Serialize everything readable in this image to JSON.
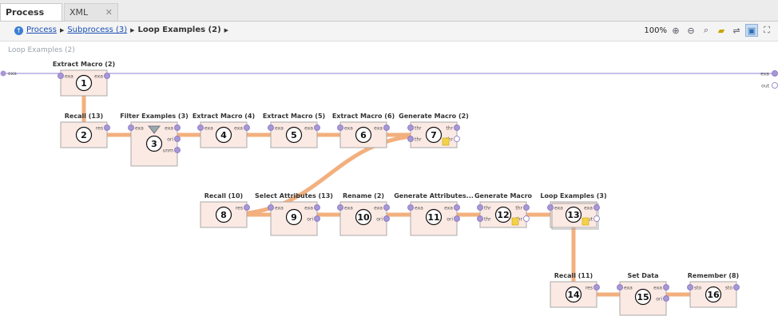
{
  "tabs": [
    {
      "label": "Process",
      "active": true
    },
    {
      "label": "XML",
      "active": false
    }
  ],
  "breadcrumb": {
    "items": [
      "Process",
      "Subprocess (3)",
      "Loop Examples (2)"
    ]
  },
  "toolbar": {
    "zoom": "100%",
    "tools": [
      "zoom-in-icon",
      "zoom-out-icon",
      "zoom-fit-icon",
      "add-note-icon",
      "auto-wire-icon",
      "toggle-view-icon",
      "fullscreen-icon"
    ]
  },
  "canvas": {
    "title": "Loop Examples (2)",
    "left_port": "exa",
    "right_ports": [
      "exa",
      "out"
    ]
  },
  "operators": [
    {
      "id": 1,
      "title": "Extract Macro (2)",
      "in": [
        "exa"
      ],
      "out": [
        "exa"
      ]
    },
    {
      "id": 2,
      "title": "Recall (13)",
      "in": [],
      "out": [
        "res"
      ]
    },
    {
      "id": 3,
      "title": "Filter Examples (3)",
      "in": [
        "exa"
      ],
      "out": [
        "exa",
        "ori",
        "unm"
      ]
    },
    {
      "id": 4,
      "title": "Extract Macro (4)",
      "in": [
        "exa"
      ],
      "out": [
        "exa"
      ]
    },
    {
      "id": 5,
      "title": "Extract Macro (5)",
      "in": [
        "exa"
      ],
      "out": [
        "exa"
      ]
    },
    {
      "id": 6,
      "title": "Extract Macro (6)",
      "in": [
        "exa"
      ],
      "out": [
        "exa"
      ]
    },
    {
      "id": 7,
      "title": "Generate Macro (2)",
      "in": [
        "thr",
        "thr"
      ],
      "out": [
        "thr",
        "thr"
      ]
    },
    {
      "id": 8,
      "title": "Recall (10)",
      "in": [],
      "out": [
        "res"
      ]
    },
    {
      "id": 9,
      "title": "Select Attributes (13)",
      "in": [
        "exa"
      ],
      "out": [
        "exa",
        "ori"
      ]
    },
    {
      "id": 10,
      "title": "Rename (2)",
      "in": [
        "exa"
      ],
      "out": [
        "exa",
        "ori"
      ]
    },
    {
      "id": 11,
      "title": "Generate Attributes...",
      "in": [
        "exa"
      ],
      "out": [
        "exa",
        "ori"
      ]
    },
    {
      "id": 12,
      "title": "Generate Macro",
      "in": [
        "thr",
        "thr"
      ],
      "out": [
        "thr",
        "thr"
      ]
    },
    {
      "id": 13,
      "title": "Loop Examples (3)",
      "in": [
        "exa"
      ],
      "out": [
        "exa",
        "out"
      ]
    },
    {
      "id": 14,
      "title": "Recall (11)",
      "in": [],
      "out": [
        "res"
      ]
    },
    {
      "id": 15,
      "title": "Set Data",
      "in": [
        "exa"
      ],
      "out": [
        "exa",
        "ori"
      ]
    },
    {
      "id": 16,
      "title": "Remember (8)",
      "in": [
        "sto"
      ],
      "out": [
        "sto"
      ]
    }
  ],
  "colors": {
    "operator_fill": "#fbe9e3",
    "operator_border": "#a9a9a9",
    "link": "#f2b07e",
    "port": "#a797d4",
    "port_line": "#8f80d0",
    "title_text": "#333333"
  }
}
